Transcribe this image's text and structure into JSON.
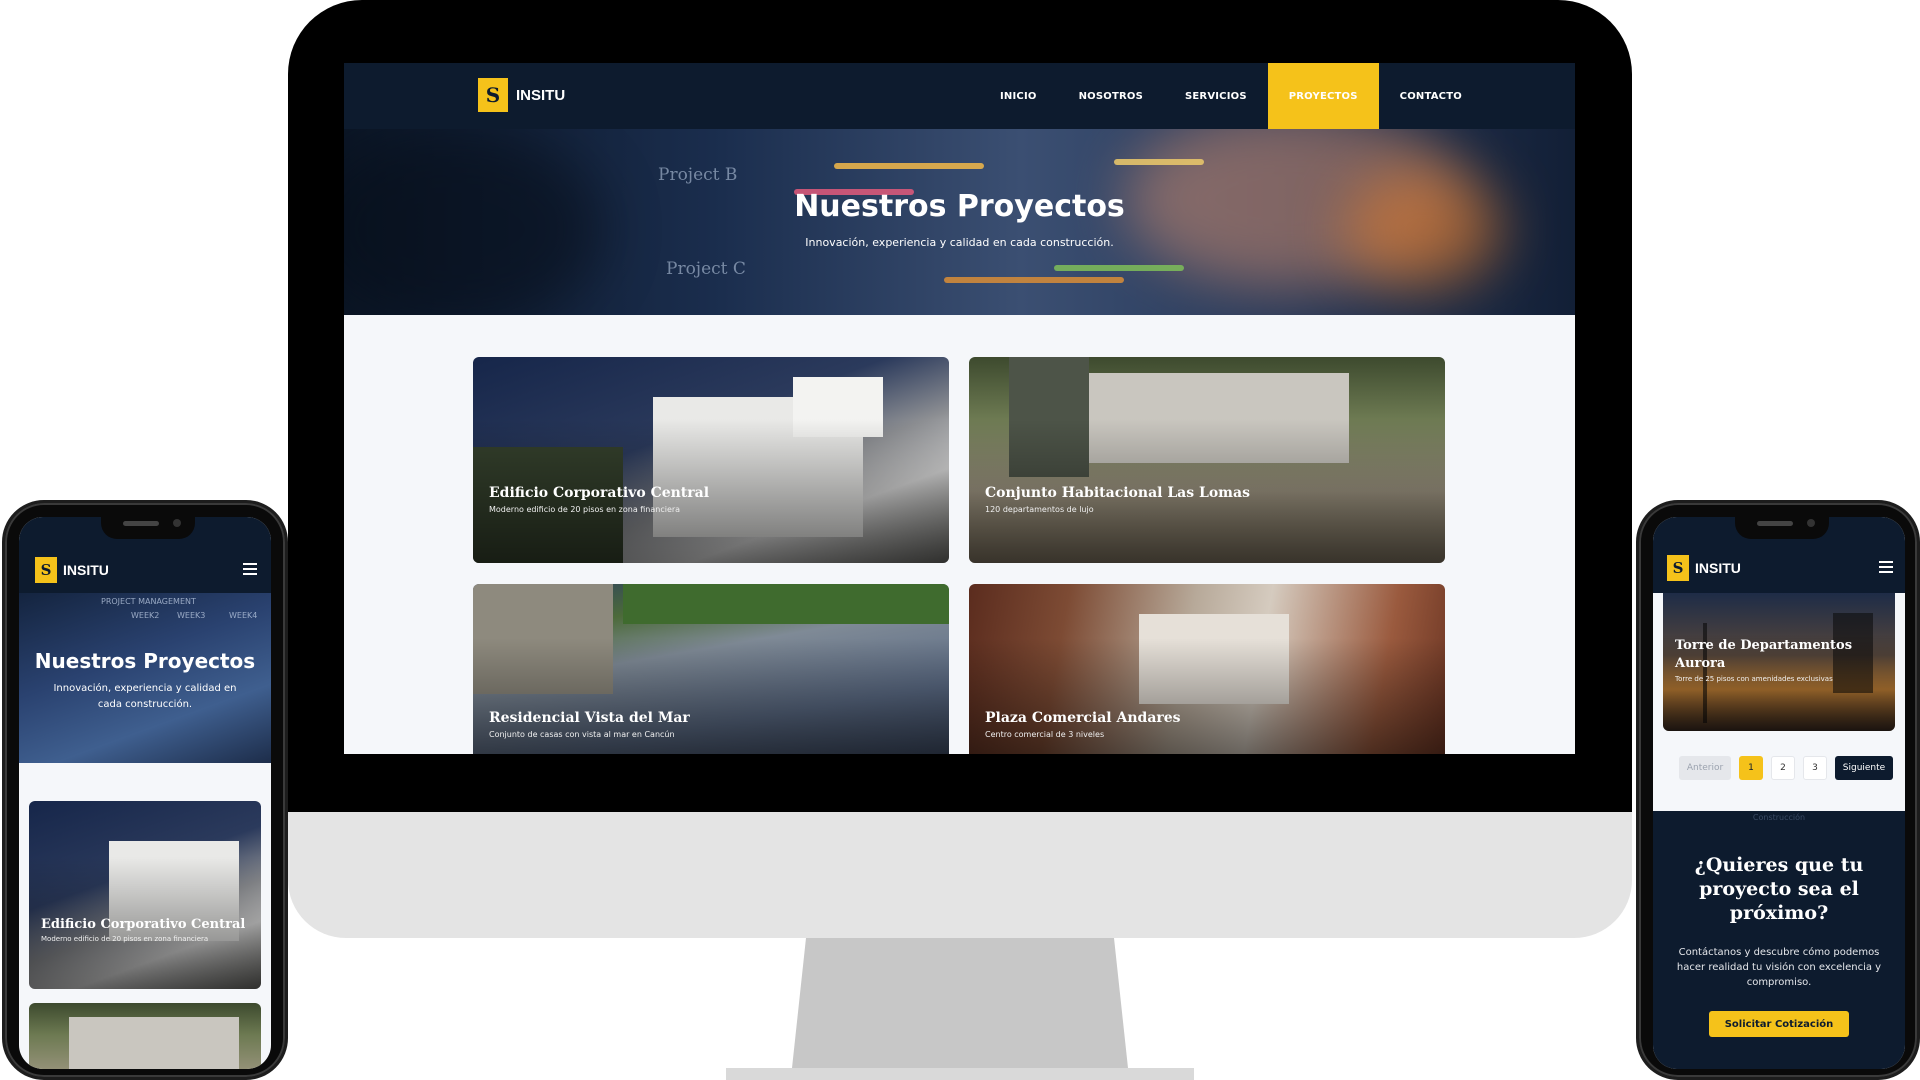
{
  "brand": {
    "name": "INSITU",
    "logo_letter": "S"
  },
  "nav": {
    "items": [
      {
        "label": "INICIO"
      },
      {
        "label": "NOSOTROS"
      },
      {
        "label": "SERVICIOS"
      },
      {
        "label": "PROYECTOS"
      },
      {
        "label": "CONTACTO"
      }
    ],
    "active": "PROYECTOS"
  },
  "hero": {
    "title": "Nuestros Proyectos",
    "subtitle": "Innovación, experiencia y calidad en cada construcción.",
    "bg_labels": [
      "Project B",
      "Project C",
      "PROJECT MANAGEMENT",
      "WEEK2",
      "WEEK3",
      "WEEK4"
    ]
  },
  "projects": [
    {
      "title": "Edificio Corporativo Central",
      "desc": "Moderno edificio de 20 pisos en zona financiera"
    },
    {
      "title": "Conjunto Habitacional Las Lomas",
      "desc": "120 departamentos de lujo"
    },
    {
      "title": "Residencial Vista del Mar",
      "desc": "Conjunto de casas con vista al mar en Cancún"
    },
    {
      "title": "Plaza Comercial Andares",
      "desc": "Centro comercial de 3 niveles"
    },
    {
      "title": "Torre de Departamentos Aurora",
      "desc": "Torre de 25 pisos con amenidades exclusivas"
    }
  ],
  "pagination": {
    "prev": "Anterior",
    "pages": [
      "1",
      "2",
      "3"
    ],
    "current": "1",
    "next": "Siguiente"
  },
  "cta": {
    "faded_label": "Construcción",
    "title": "¿Quieres que tu proyecto sea el próximo?",
    "text": "Contáctanos y descubre cómo podemos hacer realidad tu visión con excelencia y compromiso.",
    "button": "Solicitar Cotización"
  },
  "colors": {
    "navy": "#0d1b2e",
    "accent": "#f5c21a",
    "page_bg": "#f5f7fa"
  },
  "icons": {
    "menu": "hamburger-menu-icon"
  }
}
